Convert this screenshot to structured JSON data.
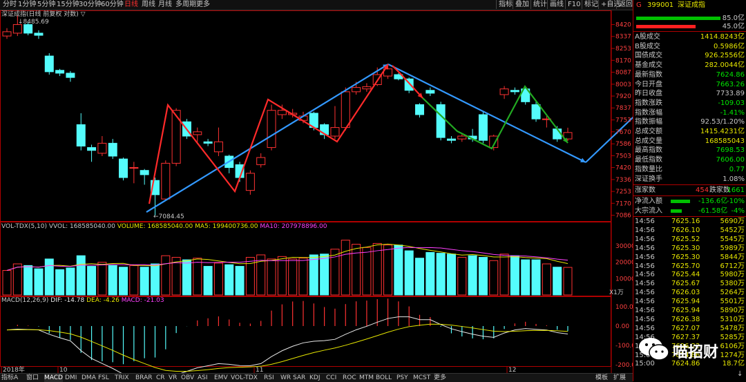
{
  "toolbar": {
    "periods": [
      "分时",
      "1分钟",
      "5分钟",
      "15分钟",
      "30分钟",
      "60分钟",
      "日线",
      "周线",
      "月线",
      "多周期",
      "更多"
    ],
    "active_period": 6,
    "right_buttons": [
      "指标",
      "叠加",
      "统计",
      "画线",
      "F10",
      "标记",
      "+自选",
      "返回"
    ]
  },
  "chart_title": "深证成指(日线 前复权 对数)",
  "price_axis": [
    "8420",
    "8337",
    "8253",
    "8170",
    "8087",
    "8003",
    "7920",
    "7837",
    "7753",
    "7670",
    "7586",
    "7503",
    "7420",
    "7336",
    "7253",
    "7170",
    "7086"
  ],
  "price_labels": {
    "high": "8485.69",
    "low": "7084.45"
  },
  "volume_panel": {
    "title": "VOL-TDX(5,10)",
    "vvol": "VVOL: 168585040.00",
    "volume": "VOLUME: 168585040.00",
    "ma5": "MA5: 199400736.00",
    "ma10": "MA10: 207978896.00",
    "axis": [
      "30000",
      "20000",
      "10000"
    ],
    "unit": "X1万"
  },
  "macd_panel": {
    "title": "MACD(12,26,9)",
    "dif": "DIF: -14.78",
    "dea": "DEA: -4.26",
    "macd": "MACD: -21.03",
    "axis": [
      "100.0",
      "0.00",
      "-100.0",
      "-200.0"
    ]
  },
  "date_axis": [
    "2018年",
    "10",
    "11",
    "12"
  ],
  "bottom_tabs": [
    "指标A",
    "窗口",
    "MACD",
    "DMI",
    "DMA",
    "FSL",
    "TRIX",
    "BRAR",
    "CR",
    "VR",
    "OBV",
    "ASI",
    "EMV",
    "VOL-TDX",
    "RSI",
    "WR",
    "SAR",
    "KDJ",
    "CCI",
    "ROC",
    "MTM",
    "BOLL",
    "PSY",
    "MCST",
    "更多"
  ],
  "bottom_right_tabs": [
    "模板",
    "扩展"
  ],
  "active_bottom_tab": 2,
  "right_panel": {
    "header_letter": "G",
    "code": "399001",
    "name": "深证成指",
    "bar_top_pct": "85.0亿",
    "bar_bottom_pct": "45.0亿",
    "stats": [
      {
        "label": "A股成交",
        "value": "1414.8243亿",
        "color": "#e6e600"
      },
      {
        "label": "B股成交",
        "value": "0.5986亿",
        "color": "#e6e600"
      },
      {
        "label": "国债成交",
        "value": "926.2556亿",
        "color": "#e6e600"
      },
      {
        "label": "基金成交",
        "value": "282.0044亿",
        "color": "#e6e600"
      },
      {
        "label": "最新指数",
        "value": "7624.86",
        "color": "#00e600"
      },
      {
        "label": "今日开盘",
        "value": "7663.26",
        "color": "#00e600"
      },
      {
        "label": "昨日收盘",
        "value": "7733.89",
        "color": "#c8c8c8"
      },
      {
        "label": "指数涨跌",
        "value": "-109.03",
        "color": "#00e600"
      },
      {
        "label": "指数涨幅",
        "value": "-1.41%",
        "color": "#00e600"
      },
      {
        "label": "指数振幅",
        "value": "92.53/1.20%",
        "color": "#c8c8c8"
      },
      {
        "label": "总成交额",
        "value": "1415.4231亿",
        "color": "#e6e600"
      },
      {
        "label": "总成交量",
        "value": "168585043",
        "color": "#e6e600"
      },
      {
        "label": "最高指数",
        "value": "7698.53",
        "color": "#00e600"
      },
      {
        "label": "最低指数",
        "value": "7606.00",
        "color": "#00e600"
      },
      {
        "label": "指数量比",
        "value": "0.77",
        "color": "#00e600"
      },
      {
        "label": "深证换手",
        "value": "1.08%",
        "color": "#c8c8c8"
      }
    ],
    "rise_label": "涨家数",
    "rise_count": "454",
    "fall_label": "跌家数",
    "fall_count": "1661",
    "net_inflow_label": "净流入额",
    "net_inflow": "-136.6亿",
    "net_inflow_pct": "-10%",
    "block_inflow_label": "大宗流入",
    "block_inflow": "-61.58亿",
    "block_inflow_pct": "-4%",
    "ticks": [
      {
        "time": "14:56",
        "price": "7625.16",
        "vol": "5690万"
      },
      {
        "time": "14:56",
        "price": "7626.10",
        "vol": "5452万"
      },
      {
        "time": "14:56",
        "price": "7625.52",
        "vol": "5545万"
      },
      {
        "time": "14:56",
        "price": "7625.30",
        "vol": "5989万"
      },
      {
        "time": "14:56",
        "price": "7625.30",
        "vol": "5844万"
      },
      {
        "time": "14:56",
        "price": "7625.70",
        "vol": "6712万"
      },
      {
        "time": "14:56",
        "price": "7625.44",
        "vol": "5980万"
      },
      {
        "time": "14:56",
        "price": "7625.67",
        "vol": "5380万"
      },
      {
        "time": "14:56",
        "price": "7626.03",
        "vol": "5264万"
      },
      {
        "time": "14:56",
        "price": "7625.94",
        "vol": "5501万"
      },
      {
        "time": "14:56",
        "price": "7625.94",
        "vol": "5890万"
      },
      {
        "time": "14:56",
        "price": "7626.38",
        "vol": "5310万"
      },
      {
        "time": "14:56",
        "price": "7627.07",
        "vol": "5478万"
      },
      {
        "time": "14:56",
        "price": "7627.37",
        "vol": "5285万"
      },
      {
        "time": "14:56",
        "price": "7626.22",
        "vol": "6106万"
      },
      {
        "time": "15:00",
        "price": "7624.86",
        "vol": "1274万"
      },
      {
        "time": "15:00",
        "price": "7624.86",
        "vol": "18.7亿"
      }
    ],
    "tick_arrow": "↓"
  },
  "watermark": "喵招财",
  "colors": {
    "up": "#ff3232",
    "down": "#54fcfc",
    "trend_blue": "#3399ff",
    "trend_green": "#22aa22"
  },
  "candles": [
    {
      "o": 8340,
      "c": 8370,
      "h": 8395,
      "l": 8320
    },
    {
      "o": 8360,
      "c": 8420,
      "h": 8485.69,
      "l": 8340
    },
    {
      "o": 8420,
      "c": 8360,
      "h": 8435,
      "l": 8345
    },
    {
      "o": 8360,
      "c": 8345,
      "h": 8380,
      "l": 8320
    },
    {
      "o": 8200,
      "c": 8090,
      "h": 8220,
      "l": 8070
    },
    {
      "o": 8100,
      "c": 8080,
      "h": 8110,
      "l": 8060
    },
    {
      "o": 8080,
      "c": 8050,
      "h": 8095,
      "l": 8020
    },
    {
      "o": 7720,
      "c": 7570,
      "h": 7800,
      "l": 7540
    },
    {
      "o": 7560,
      "c": 7540,
      "h": 7580,
      "l": 7460
    },
    {
      "o": 7520,
      "c": 7590,
      "h": 7640,
      "l": 7500
    },
    {
      "o": 7590,
      "c": 7500,
      "h": 7620,
      "l": 7480
    },
    {
      "o": 7480,
      "c": 7350,
      "h": 7490,
      "l": 7330
    },
    {
      "o": 7420,
      "c": 7420,
      "h": 7460,
      "l": 7310
    },
    {
      "o": 7400,
      "c": 7370,
      "h": 7410,
      "l": 7300
    },
    {
      "o": 7330,
      "c": 7230,
      "h": 7350,
      "l": 7084.45
    },
    {
      "o": 7200,
      "c": 7450,
      "h": 7470,
      "l": 7190
    },
    {
      "o": 7450,
      "c": 7820,
      "h": 7835,
      "l": 7430
    },
    {
      "o": 7740,
      "c": 7640,
      "h": 7760,
      "l": 7620
    },
    {
      "o": 7650,
      "c": 7670,
      "h": 7700,
      "l": 7600
    },
    {
      "o": 7600,
      "c": 7590,
      "h": 7620,
      "l": 7570
    },
    {
      "o": 7530,
      "c": 7600,
      "h": 7700,
      "l": 7500
    },
    {
      "o": 7500,
      "c": 7420,
      "h": 7510,
      "l": 7380
    },
    {
      "o": 7440,
      "c": 7350,
      "h": 7460,
      "l": 7320
    },
    {
      "o": 7260,
      "c": 7380,
      "h": 7400,
      "l": 7230
    },
    {
      "o": 7440,
      "c": 7490,
      "h": 7520,
      "l": 7420
    },
    {
      "o": 7560,
      "c": 7820,
      "h": 7860,
      "l": 7540
    },
    {
      "o": 7790,
      "c": 7820,
      "h": 7860,
      "l": 7760
    },
    {
      "o": 7790,
      "c": 7800,
      "h": 7830,
      "l": 7770
    },
    {
      "o": 7750,
      "c": 7780,
      "h": 7810,
      "l": 7730
    },
    {
      "o": 7800,
      "c": 7700,
      "h": 7810,
      "l": 7680
    },
    {
      "o": 7720,
      "c": 7650,
      "h": 7730,
      "l": 7620
    },
    {
      "o": 7640,
      "c": 7700,
      "h": 7850,
      "l": 7620
    },
    {
      "o": 7700,
      "c": 7950,
      "h": 7980,
      "l": 7680
    },
    {
      "o": 7950,
      "c": 7980,
      "h": 8020,
      "l": 7930
    },
    {
      "o": 7970,
      "c": 7985,
      "h": 8010,
      "l": 7950
    },
    {
      "o": 8000,
      "c": 8070,
      "h": 8120,
      "l": 7990
    },
    {
      "o": 8060,
      "c": 8110,
      "h": 8130,
      "l": 8040
    },
    {
      "o": 8070,
      "c": 8040,
      "h": 8080,
      "l": 8030
    },
    {
      "o": 8040,
      "c": 7960,
      "h": 8050,
      "l": 7940
    },
    {
      "o": 7860,
      "c": 7790,
      "h": 7870,
      "l": 7770
    },
    {
      "o": 7960,
      "c": 7940,
      "h": 7980,
      "l": 7920
    },
    {
      "o": 7860,
      "c": 7630,
      "h": 7880,
      "l": 7610
    },
    {
      "o": 7620,
      "c": 7610,
      "h": 7640,
      "l": 7590
    },
    {
      "o": 7620,
      "c": 7640,
      "h": 7660,
      "l": 7600
    },
    {
      "o": 7640,
      "c": 7620,
      "h": 7690,
      "l": 7600
    },
    {
      "o": 7790,
      "c": 7610,
      "h": 7810,
      "l": 7590
    },
    {
      "o": 7560,
      "c": 7640,
      "h": 7650,
      "l": 7540
    },
    {
      "o": 7930,
      "c": 7970,
      "h": 7990,
      "l": 7900
    },
    {
      "o": 7960,
      "c": 7950,
      "h": 7980,
      "l": 7930
    },
    {
      "o": 7970,
      "c": 7880,
      "h": 7980,
      "l": 7860
    },
    {
      "o": 7860,
      "c": 7760,
      "h": 7880,
      "l": 7740
    },
    {
      "o": 7760,
      "c": 7760,
      "h": 7780,
      "l": 7700
    },
    {
      "o": 7690,
      "c": 7620,
      "h": 7710,
      "l": 7600
    },
    {
      "o": 7620,
      "c": 7665,
      "h": 7698.53,
      "l": 7606
    }
  ],
  "volumes": [
    15000,
    19000,
    18000,
    16000,
    22000,
    15500,
    16500,
    24000,
    17500,
    20000,
    18000,
    17000,
    18000,
    17000,
    19000,
    24000,
    23000,
    21500,
    22500,
    17500,
    19500,
    18500,
    17500,
    23000,
    24500,
    22000,
    23500,
    22000,
    22500,
    24500,
    25000,
    28000,
    33500,
    31000,
    29000,
    31500,
    30500,
    30500,
    27000,
    22500,
    26000,
    25500,
    25000,
    23000,
    24000,
    23000,
    21000,
    25000,
    24000,
    21500,
    21500,
    19000,
    17000,
    16858.5
  ]
}
